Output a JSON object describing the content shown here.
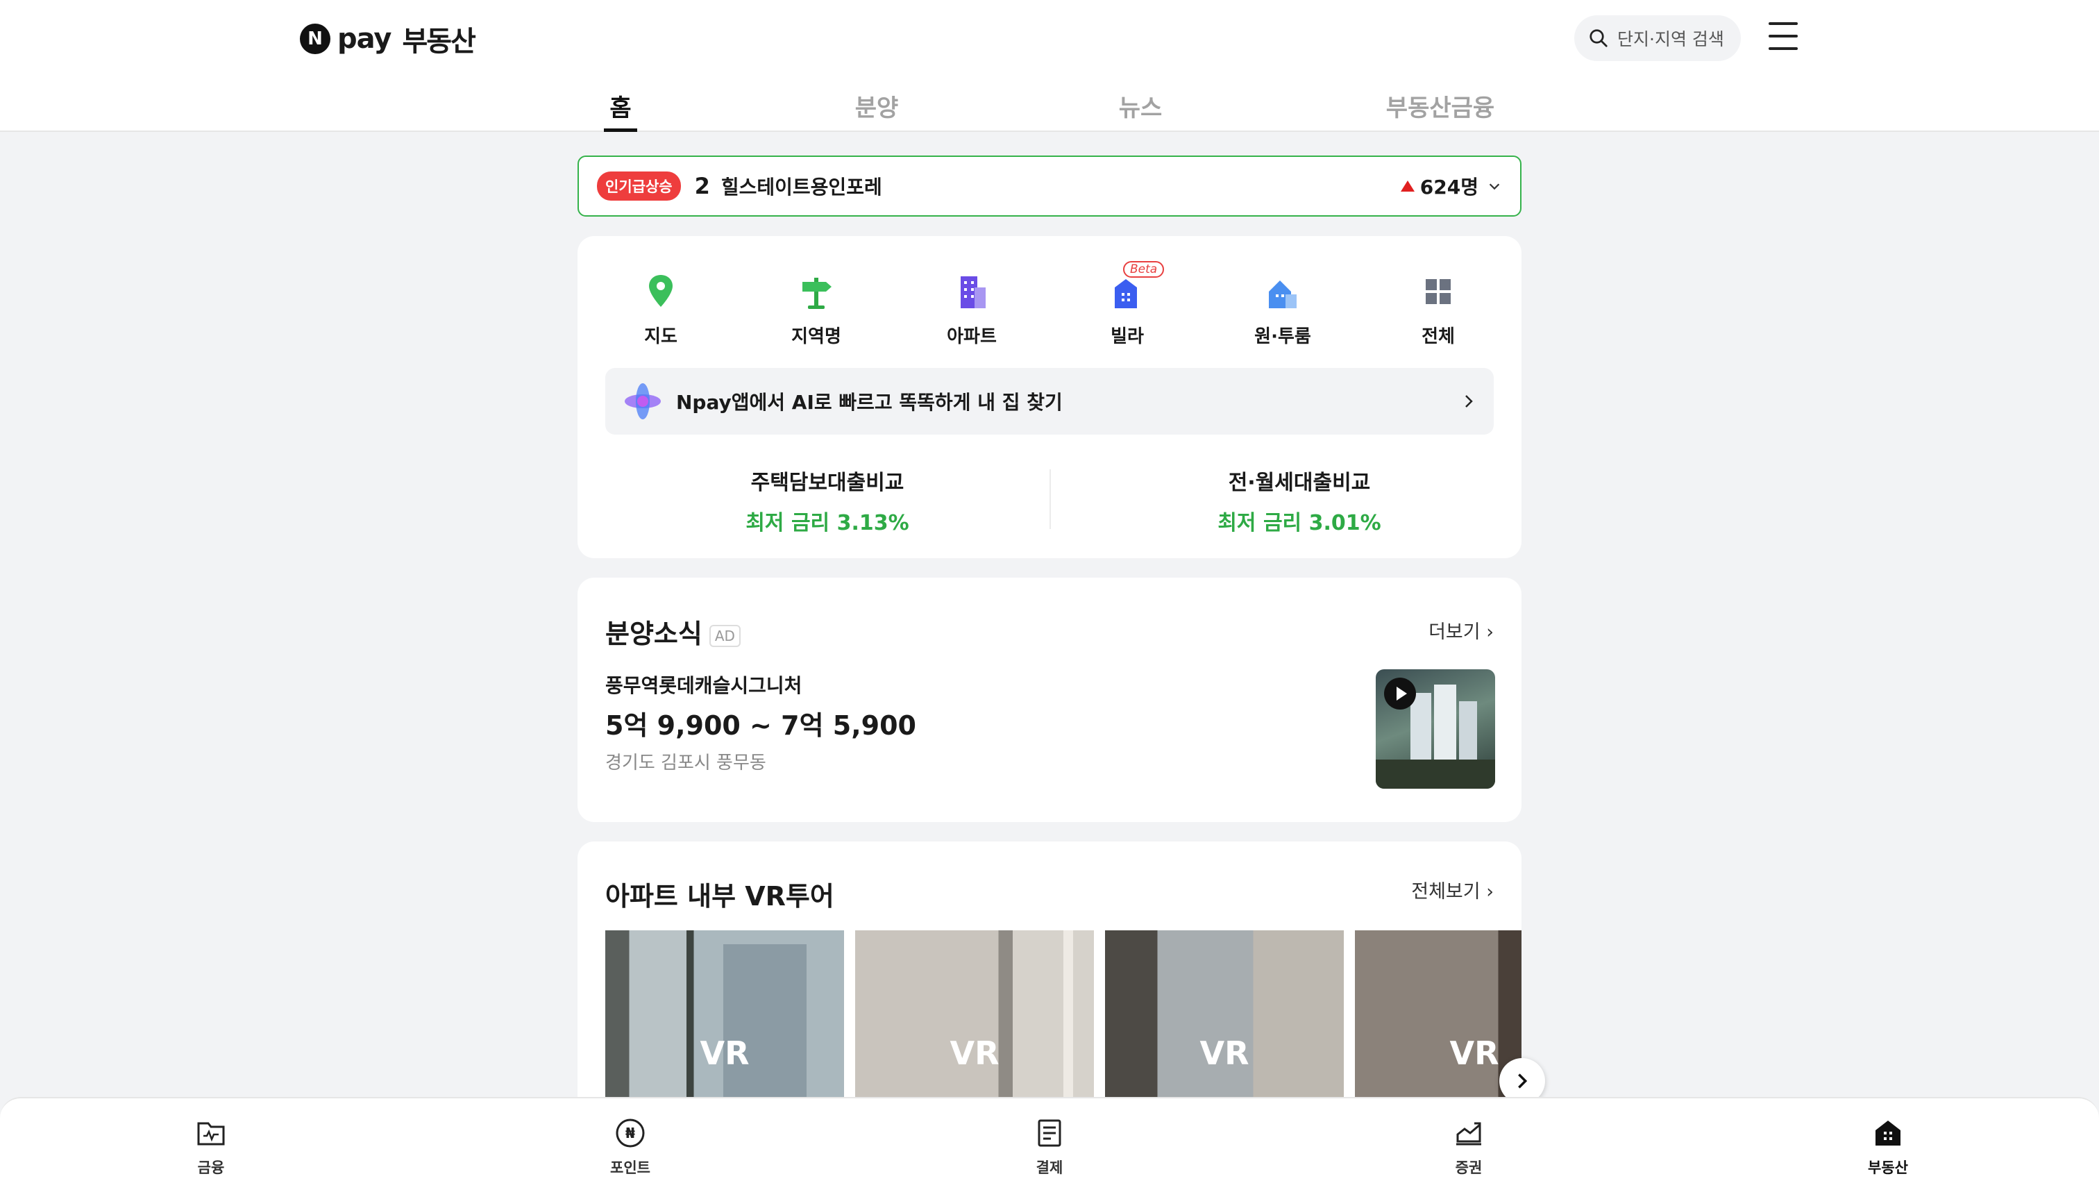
{
  "header": {
    "logo_n": "N",
    "logo_pay": "pay",
    "logo_text": "부동산",
    "search_placeholder": "단지·지역 검색"
  },
  "tabs": [
    {
      "label": "홈",
      "active": true
    },
    {
      "label": "분양",
      "active": false
    },
    {
      "label": "뉴스",
      "active": false
    },
    {
      "label": "부동산금융",
      "active": false
    }
  ],
  "trending": {
    "badge": "인기급상승",
    "rank": "2",
    "name": "힐스테이트용인포레",
    "count": "624명"
  },
  "categories": [
    {
      "label": "지도",
      "icon": "map-pin-icon"
    },
    {
      "label": "지역명",
      "icon": "signpost-icon"
    },
    {
      "label": "아파트",
      "icon": "apartment-icon"
    },
    {
      "label": "빌라",
      "icon": "villa-icon",
      "badge": "Beta"
    },
    {
      "label": "원·투룸",
      "icon": "room-icon"
    },
    {
      "label": "전체",
      "icon": "grid-icon"
    }
  ],
  "ai_banner": "Npay앱에서 AI로 빠르고 똑똑하게 내 집 찾기",
  "loans": [
    {
      "title": "주택담보대출비교",
      "rate": "최저 금리 3.13%"
    },
    {
      "title": "전·월세대출비교",
      "rate": "최저 금리 3.01%"
    }
  ],
  "presale": {
    "title": "분양소식",
    "ad": "AD",
    "more": "더보기",
    "name": "풍무역롯데캐슬시그니처",
    "price": "5억 9,900 ~ 7억 5,900",
    "location": "경기도 김포시 풍무동"
  },
  "vr": {
    "title": "아파트 내부 VR투어",
    "more": "전체보기",
    "label": "VR"
  },
  "bottom_nav": [
    {
      "label": "금융",
      "icon": "finance-folder-icon"
    },
    {
      "label": "포인트",
      "icon": "point-coin-icon"
    },
    {
      "label": "결제",
      "icon": "receipt-icon"
    },
    {
      "label": "증권",
      "icon": "stock-chart-icon"
    },
    {
      "label": "부동산",
      "icon": "home-building-icon",
      "active": true
    }
  ],
  "colors": {
    "accent_green": "#2eaa45",
    "badge_red": "#ee3d3d",
    "banner_border": "#35b24a"
  }
}
